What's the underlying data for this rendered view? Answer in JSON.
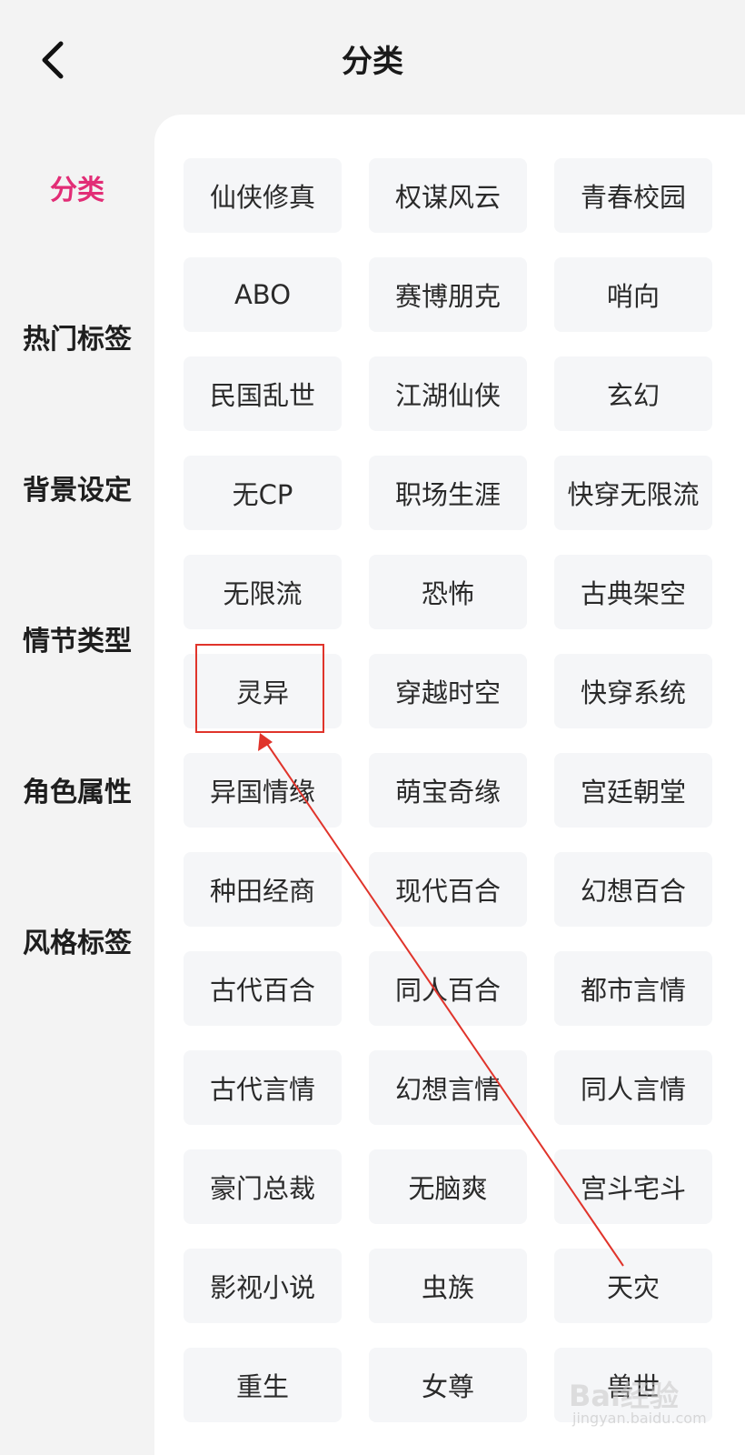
{
  "header": {
    "title": "分类",
    "back_icon": "chevron-left-icon"
  },
  "sidebar": {
    "active_color": "#e22d76",
    "items": [
      {
        "label": "分类",
        "active": true
      },
      {
        "label": "热门标签",
        "active": false
      },
      {
        "label": "背景设定",
        "active": false
      },
      {
        "label": "情节类型",
        "active": false
      },
      {
        "label": "角色属性",
        "active": false
      },
      {
        "label": "风格标签",
        "active": false
      }
    ]
  },
  "tags": [
    "仙侠修真",
    "权谋风云",
    "青春校园",
    "ABO",
    "赛博朋克",
    "哨向",
    "民国乱世",
    "江湖仙侠",
    "玄幻",
    "无CP",
    "职场生涯",
    "快穿无限流",
    "无限流",
    "恐怖",
    "古典架空",
    "灵异",
    "穿越时空",
    "快穿系统",
    "异国情缘",
    "萌宝奇缘",
    "宫廷朝堂",
    "种田经商",
    "现代百合",
    "幻想百合",
    "古代百合",
    "同人百合",
    "都市言情",
    "古代言情",
    "幻想言情",
    "同人言情",
    "豪门总裁",
    "无脑爽",
    "宫斗宅斗",
    "影视小说",
    "虫族",
    "天灾",
    "重生",
    "女尊",
    "兽世"
  ],
  "annotation": {
    "color": "#e0342b",
    "highlighted_tag": "灵异"
  },
  "watermark": {
    "main": "Bai经验",
    "sub": "jingyan.baidu.com"
  }
}
